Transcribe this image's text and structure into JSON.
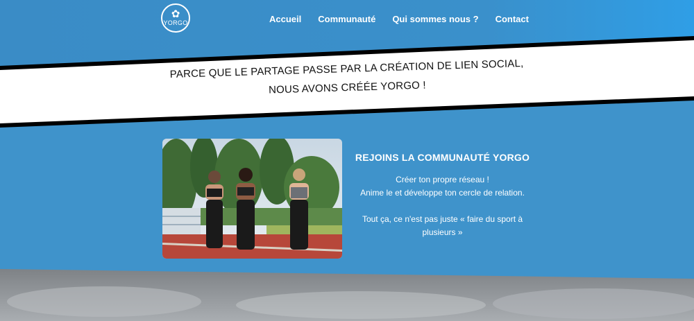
{
  "header": {
    "logo_text": "YORGO",
    "nav": [
      "Accueil",
      "Communauté",
      "Qui sommes nous ?",
      "Contact"
    ]
  },
  "banner": {
    "line1": "Parce que le partage passe par la création de lien social,",
    "line2": "nous avons créée YORGO !"
  },
  "community": {
    "title": "REJOINS LA COMMUNAUTÉ YORGO",
    "line1": "Créer ton propre réseau !",
    "line2": "Anime le et développe ton cercle de relation.",
    "line3": "Tout ça, ce n'est pas juste « faire du sport à plusieurs »"
  },
  "colors": {
    "primary_blue": "#3f93cb",
    "band_white": "#ffffff",
    "band_border": "#000000"
  }
}
